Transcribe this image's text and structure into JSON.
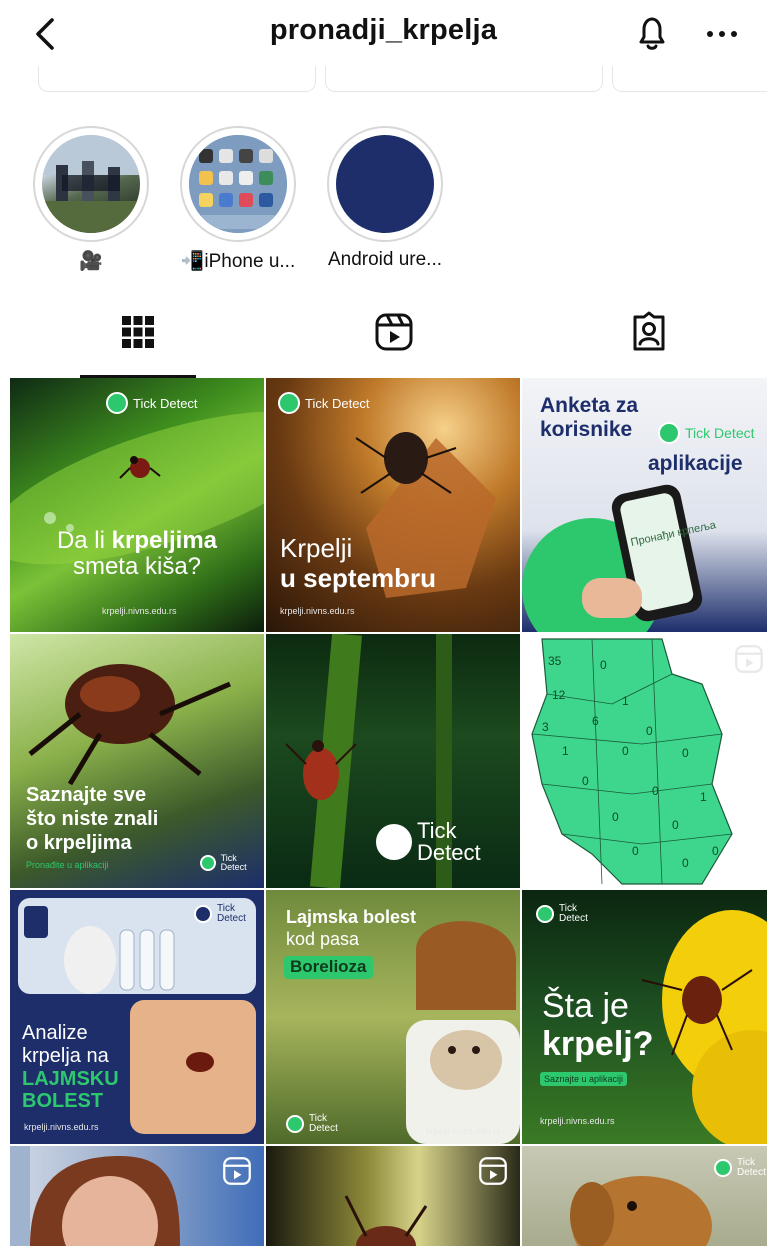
{
  "header": {
    "username": "pronadji_krpelja"
  },
  "highlights": [
    {
      "label": "🎥"
    },
    {
      "label": "📲iPhone u..."
    },
    {
      "label": "Android ure..."
    }
  ],
  "tabs": [
    "posts-grid-icon",
    "reels-icon",
    "tagged-icon"
  ],
  "posts": [
    {
      "logo": "Tick Detect",
      "line1": "Da li ",
      "line1b": "krpeljima",
      "line2": "smeta kiša?",
      "url": "krpelji.nivns.edu.rs"
    },
    {
      "logo": "Tick Detect",
      "line1": "Krpelji",
      "line2": "u septembru",
      "url": "krpelji.nivns.edu.rs"
    },
    {
      "line1": "Anketa za",
      "line2": "korisnike",
      "logo": "Tick Detect",
      "line3": "aplikacije",
      "phone_text": "Пронађи крпеља"
    },
    {
      "line1": "Saznajte sve",
      "line2": "što niste znali",
      "line3": "o krpeljima",
      "sub": "Pronađite u aplikaciji",
      "logo": "Tick Detect"
    },
    {
      "logo": "Tick Detect"
    },
    {
      "map_numbers": [
        "35",
        "0",
        "12",
        "1",
        "3",
        "6",
        "0",
        "1",
        "0",
        "0",
        "0",
        "0",
        "1",
        "0",
        "0",
        "0",
        "0",
        "0"
      ]
    },
    {
      "logo": "Tick Detect",
      "line1": "Analize",
      "line2": "krpelja na",
      "line3": "LAJMSKU",
      "line4": "BOLEST",
      "url": "krpelji.nivns.edu.rs"
    },
    {
      "line1": "Lajmska bolest",
      "line2": "kod pasa",
      "badge": "Borelioza",
      "logo": "Tick Detect",
      "url": "krpelji.nivns.edu.rs"
    },
    {
      "logo": "Tick Detect",
      "line1": "Šta je",
      "line2": "krpelj?",
      "sub": "Saznajte u aplikaciji",
      "url": "krpelji.nivns.edu.rs"
    },
    {},
    {},
    {
      "logo": "Tick Detect"
    }
  ],
  "colors": {
    "accent_green": "#2dc86d",
    "navy": "#1d2e6b",
    "map_green": "#3dd68c"
  }
}
